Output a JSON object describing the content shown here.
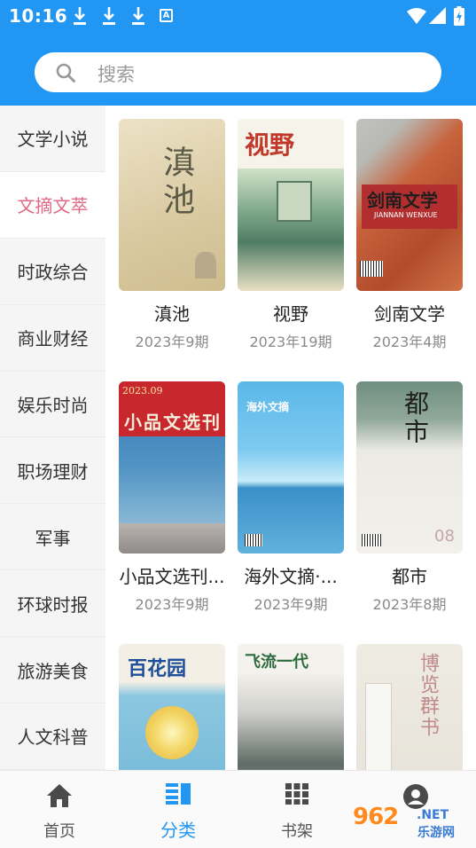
{
  "status_bar": {
    "time": "10:16",
    "a_badge": "A"
  },
  "search": {
    "placeholder": "搜索"
  },
  "categories": [
    {
      "label": "文学小说",
      "active": false
    },
    {
      "label": "文摘文萃",
      "active": true
    },
    {
      "label": "时政综合",
      "active": false
    },
    {
      "label": "商业财经",
      "active": false
    },
    {
      "label": "娱乐时尚",
      "active": false
    },
    {
      "label": "职场理财",
      "active": false
    },
    {
      "label": "军事",
      "active": false
    },
    {
      "label": "环球时报",
      "active": false
    },
    {
      "label": "旅游美食",
      "active": false
    },
    {
      "label": "人文科普",
      "active": false
    }
  ],
  "books": [
    {
      "title": "滇池",
      "issue": "2023年9期",
      "cover_text": "滇池"
    },
    {
      "title": "视野",
      "issue": "2023年19期",
      "cover_text": "视野"
    },
    {
      "title": "剑南文学",
      "issue": "2023年4期",
      "cover_text": "剑南文学",
      "cover_sub": "JIANNAN WENXUE"
    },
    {
      "title": "小品文选刊...",
      "issue": "2023年9期",
      "cover_text": "小品文选刊",
      "cover_sub": "2023.09"
    },
    {
      "title": "海外文摘·...",
      "issue": "2023年9期",
      "cover_text": "海外文摘"
    },
    {
      "title": "都市",
      "issue": "2023年8期",
      "cover_text": "都市",
      "cover_sub": "08"
    },
    {
      "title": "",
      "issue": "",
      "cover_text": "百花园"
    },
    {
      "title": "",
      "issue": "",
      "cover_text": "飞流一代"
    },
    {
      "title": "",
      "issue": "",
      "cover_text": "博览群书"
    }
  ],
  "bottom_nav": [
    {
      "label": "首页",
      "icon": "home-icon",
      "active": false
    },
    {
      "label": "分类",
      "icon": "category-icon",
      "active": true
    },
    {
      "label": "书架",
      "icon": "bookshelf-icon",
      "active": false
    },
    {
      "label": "",
      "icon": "profile-icon",
      "active": false
    }
  ],
  "watermark": {
    "number": "962",
    "domain": ".NET",
    "name": "乐游网"
  },
  "colors": {
    "primary": "#2196f3",
    "active_category": "#e06a86",
    "sidebar_bg": "#f5f5f5"
  }
}
